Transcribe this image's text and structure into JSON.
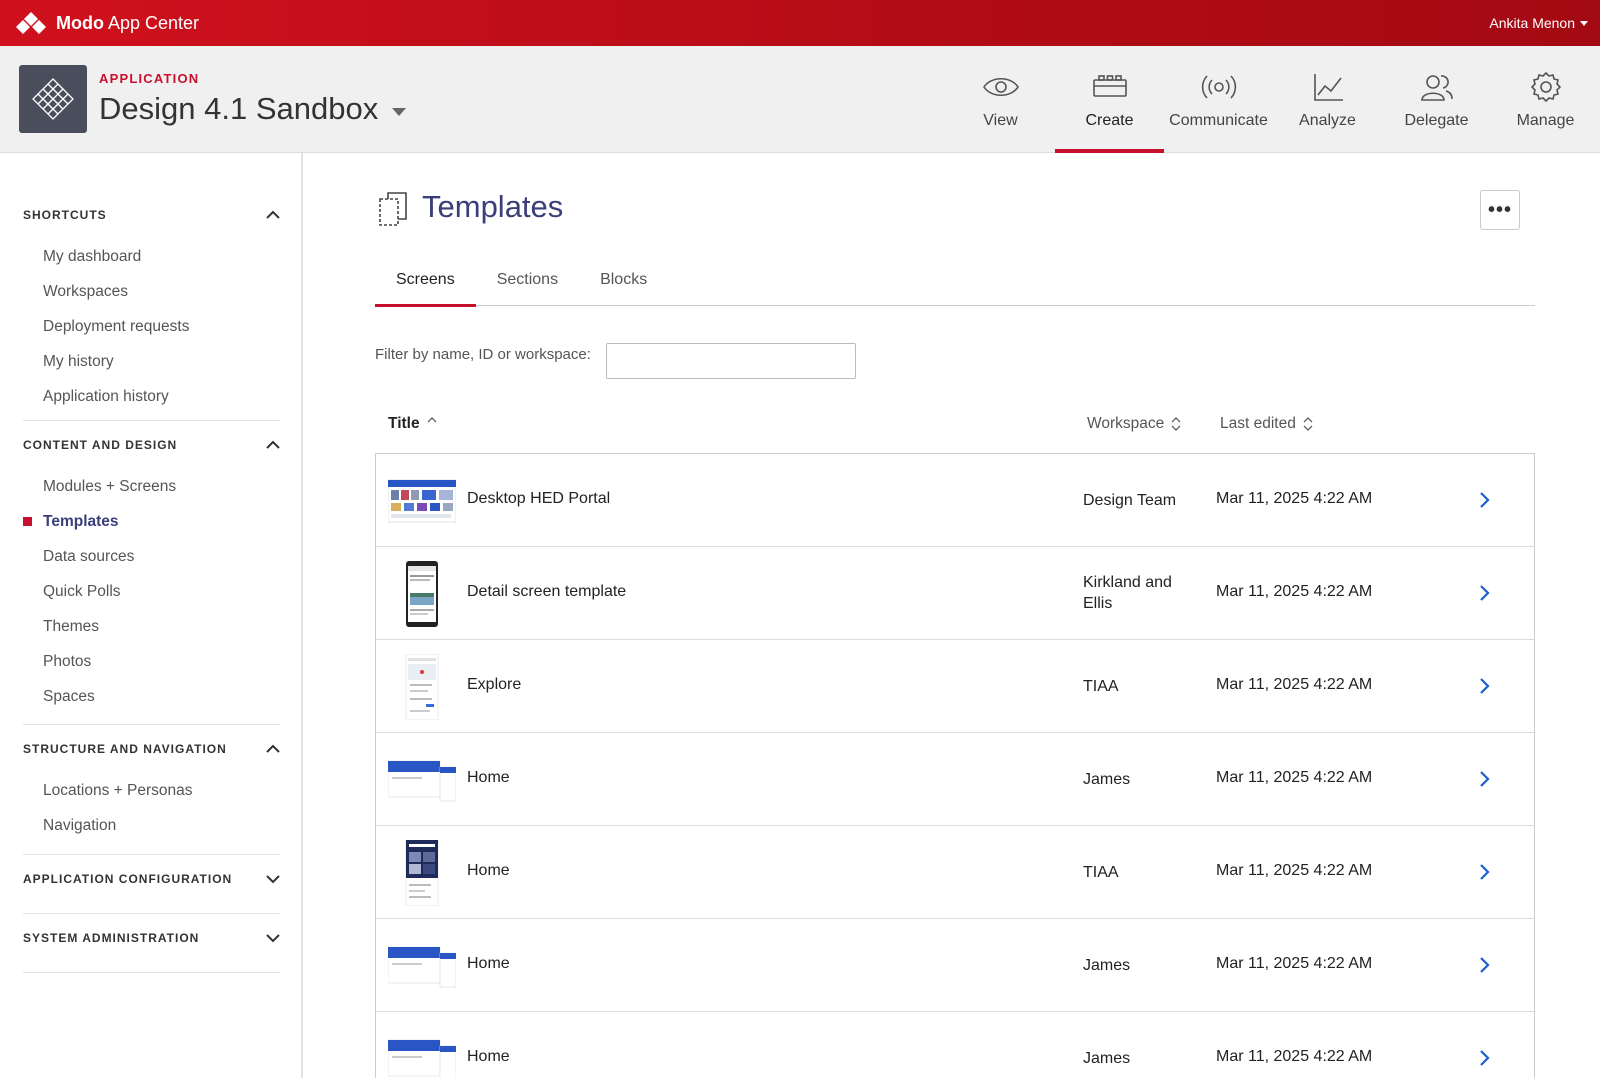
{
  "topbar": {
    "brand_bold": "Modo",
    "brand_rest": " App Center",
    "user": "Ankita Menon"
  },
  "app": {
    "kicker": "APPLICATION",
    "title": "Design 4.1 Sandbox"
  },
  "nav": [
    {
      "label": "View",
      "icon": "eye-icon"
    },
    {
      "label": "Create",
      "icon": "blocks-icon",
      "active": true
    },
    {
      "label": "Communicate",
      "icon": "broadcast-icon"
    },
    {
      "label": "Analyze",
      "icon": "chart-icon"
    },
    {
      "label": "Delegate",
      "icon": "people-icon"
    },
    {
      "label": "Manage",
      "icon": "gear-icon"
    }
  ],
  "sidebar": {
    "groups": [
      {
        "title": "SHORTCUTS",
        "items": [
          "My dashboard",
          "Workspaces",
          "Deployment requests",
          "My history",
          "Application history"
        ]
      },
      {
        "title": "CONTENT AND DESIGN",
        "items": [
          "Modules + Screens",
          "Templates",
          "Data sources",
          "Quick Polls",
          "Themes",
          "Photos",
          "Spaces"
        ]
      },
      {
        "title": "STRUCTURE AND NAVIGATION",
        "items": [
          "Locations + Personas",
          "Navigation"
        ]
      },
      {
        "title": "APPLICATION CONFIGURATION",
        "items": []
      },
      {
        "title": "SYSTEM ADMINISTRATION",
        "items": []
      }
    ],
    "active_item": "Templates"
  },
  "page": {
    "title": "Templates",
    "more_label": "•••",
    "tabs": [
      "Screens",
      "Sections",
      "Blocks"
    ],
    "active_tab": "Screens",
    "filter_label": "Filter by name, ID or workspace:",
    "filter_value": ""
  },
  "table": {
    "columns": [
      "Title",
      "Workspace",
      "Last edited"
    ],
    "rows": [
      {
        "title": "Desktop HED Portal",
        "workspace": "Design Team",
        "edited": "Mar 11, 2025 4:22 AM",
        "thumb": "desktop-portal"
      },
      {
        "title": "Detail screen template",
        "workspace": "Kirkland and Ellis",
        "edited": "Mar 11, 2025 4:22 AM",
        "thumb": "phone-dark"
      },
      {
        "title": "Explore",
        "workspace": "TIAA",
        "edited": "Mar 11, 2025 4:22 AM",
        "thumb": "phone-light"
      },
      {
        "title": "Home",
        "workspace": "James",
        "edited": "Mar 11, 2025 4:22 AM",
        "thumb": "desktop-blue"
      },
      {
        "title": "Home",
        "workspace": "TIAA",
        "edited": "Mar 11, 2025 4:22 AM",
        "thumb": "phone-navy"
      },
      {
        "title": "Home",
        "workspace": "James",
        "edited": "Mar 11, 2025 4:22 AM",
        "thumb": "desktop-blue"
      },
      {
        "title": "Home",
        "workspace": "James",
        "edited": "Mar 11, 2025 4:22 AM",
        "thumb": "desktop-blue"
      }
    ]
  },
  "colors": {
    "brand_red": "#c8102e",
    "title_navy": "#3a3f7a",
    "link_blue": "#1f5fcf"
  }
}
